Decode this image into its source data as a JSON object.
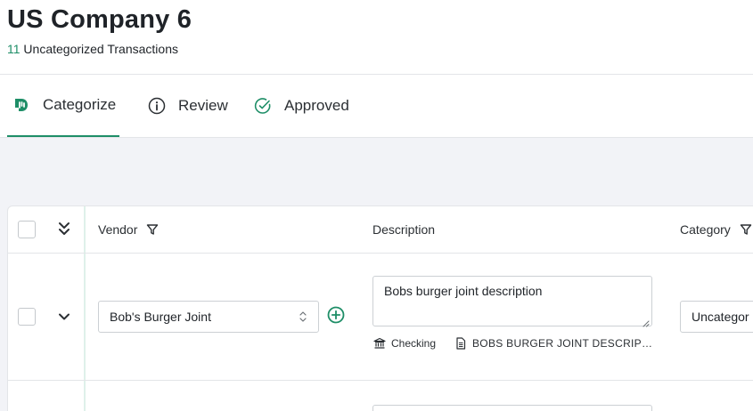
{
  "company": {
    "name": "US Company 6",
    "uncategorized_count": "11",
    "uncategorized_label": " Uncategorized Transactions"
  },
  "tabs": [
    {
      "label": "Categorize",
      "icon": "categorize-icon",
      "active": true
    },
    {
      "label": "Review",
      "icon": "info-circle-icon",
      "active": false
    },
    {
      "label": "Approved",
      "icon": "check-circle-icon",
      "active": false
    }
  ],
  "table": {
    "columns": {
      "vendor": "Vendor",
      "description": "Description",
      "category": "Category"
    },
    "rows": [
      {
        "vendor": "Bob's Burger Joint",
        "description": "Bobs burger joint description",
        "account": "Checking",
        "memo": "BOBS BURGER JOINT DESCRIP…",
        "category": "Uncategor"
      }
    ]
  },
  "colors": {
    "accent": "#1e8e67",
    "canvas": "#f2f3f7",
    "border": "#e3e5e8"
  }
}
